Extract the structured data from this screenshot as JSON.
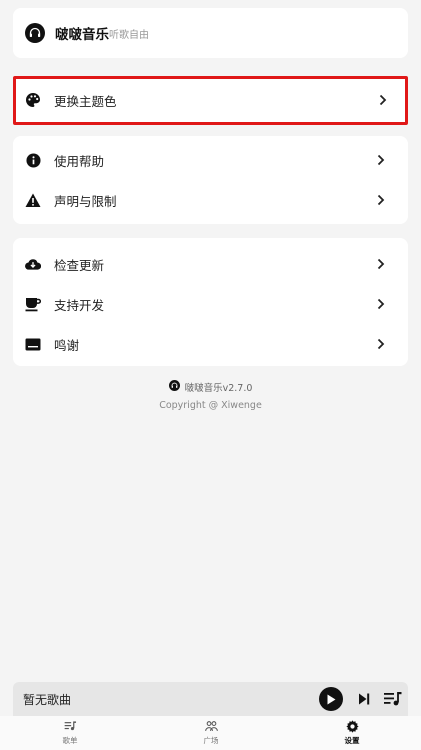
{
  "app": {
    "name": "啵啵音乐",
    "slogan": "听歌自由"
  },
  "settings": {
    "theme": {
      "label": "更换主题色"
    },
    "help_group": [
      {
        "label": "使用帮助"
      },
      {
        "label": "声明与限制"
      }
    ],
    "misc_group": [
      {
        "label": "检查更新"
      },
      {
        "label": "支持开发"
      },
      {
        "label": "鸣谢"
      }
    ]
  },
  "footer": {
    "version": "啵啵音乐v2.7.0",
    "copyright": "Copyright @ Xiwenge"
  },
  "player": {
    "song": "暂无歌曲"
  },
  "tabs": [
    {
      "label": "歌单",
      "icon": "playlist-icon",
      "active": false
    },
    {
      "label": "广场",
      "icon": "people-icon",
      "active": false
    },
    {
      "label": "设置",
      "icon": "gear-icon",
      "active": true
    }
  ],
  "colors": {
    "highlight_border": "#e01818",
    "background": "#f4f4f4"
  }
}
